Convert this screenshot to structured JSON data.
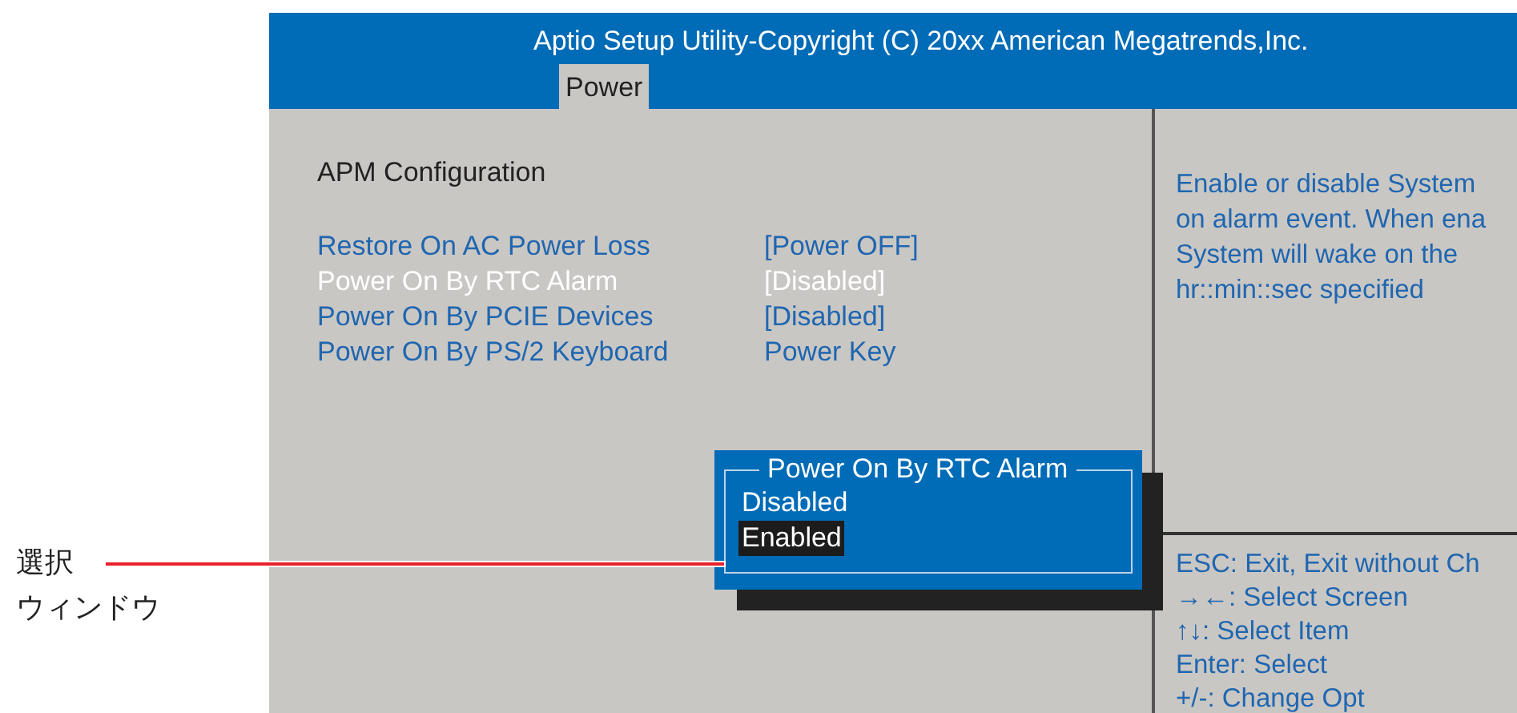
{
  "callout": {
    "lines": [
      "選択",
      "ウィンドウ"
    ]
  },
  "window": {
    "title": "Aptio Setup Utility-Copyright (C) 20xx American Megatrends,Inc."
  },
  "tabs": [
    {
      "label": "Power",
      "selected": true
    }
  ],
  "section": {
    "title": "APM  Configuration"
  },
  "settings": [
    {
      "name": "Restore On AC Power Loss",
      "value": "[Power OFF]",
      "selected": false
    },
    {
      "name": "Power On By RTC Alarm",
      "value": "[Disabled]",
      "selected": true
    },
    {
      "name": "Power On By PCIE Devices",
      "value": "[Disabled]",
      "selected": false
    },
    {
      "name": "Power On By PS/2 Keyboard",
      "value": "Power Key",
      "selected": false
    }
  ],
  "help": {
    "lines": [
      "Enable or disable System",
      "on alarm event. When ena",
      "System will wake on the",
      "hr::min::sec specified"
    ]
  },
  "keys": [
    "ESC: Exit, Exit without Ch",
    "→←: Select Screen",
    "↑↓: Select Item",
    "Enter: Select",
    "+/-: Change Opt"
  ],
  "popup": {
    "title": "Power On By RTC Alarm",
    "options": [
      {
        "label": "Disabled",
        "selected": false
      },
      {
        "label": "Enabled",
        "selected": true
      }
    ]
  }
}
